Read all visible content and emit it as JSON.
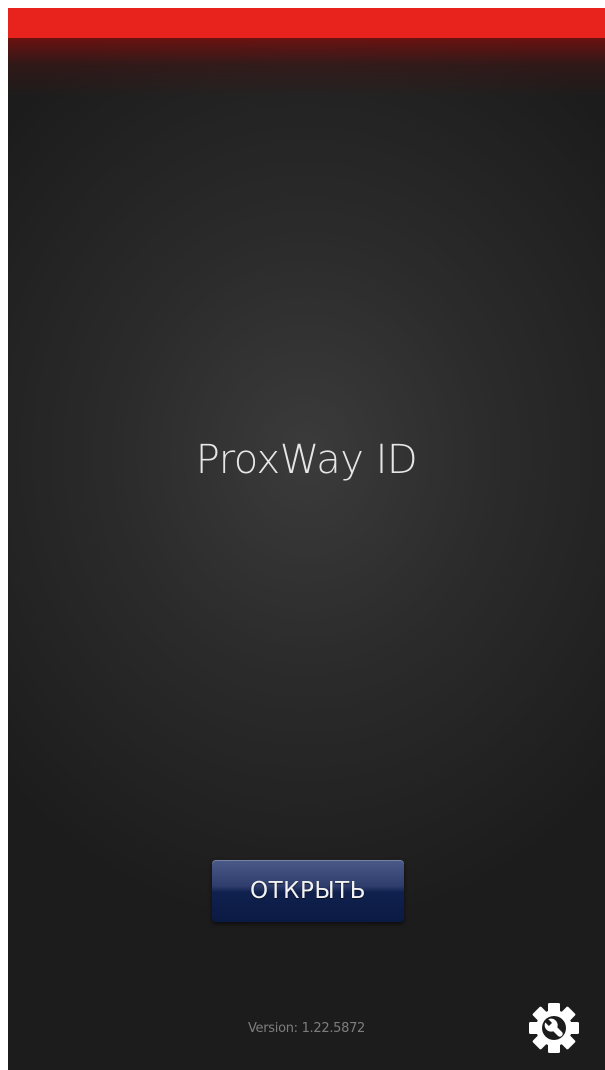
{
  "app": {
    "title": "ProxWay ID"
  },
  "actions": {
    "open_label": "ОТКРЫТЬ"
  },
  "footer": {
    "version": "Version: 1.22.5872",
    "settings_icon": "settings-wrench-gear-icon"
  },
  "colors": {
    "status_bar": "#e8231d",
    "background": "#2b2b2b",
    "button": "#1b2a58",
    "title_text": "#e6e6e6",
    "version_text": "#7d7d7d"
  }
}
